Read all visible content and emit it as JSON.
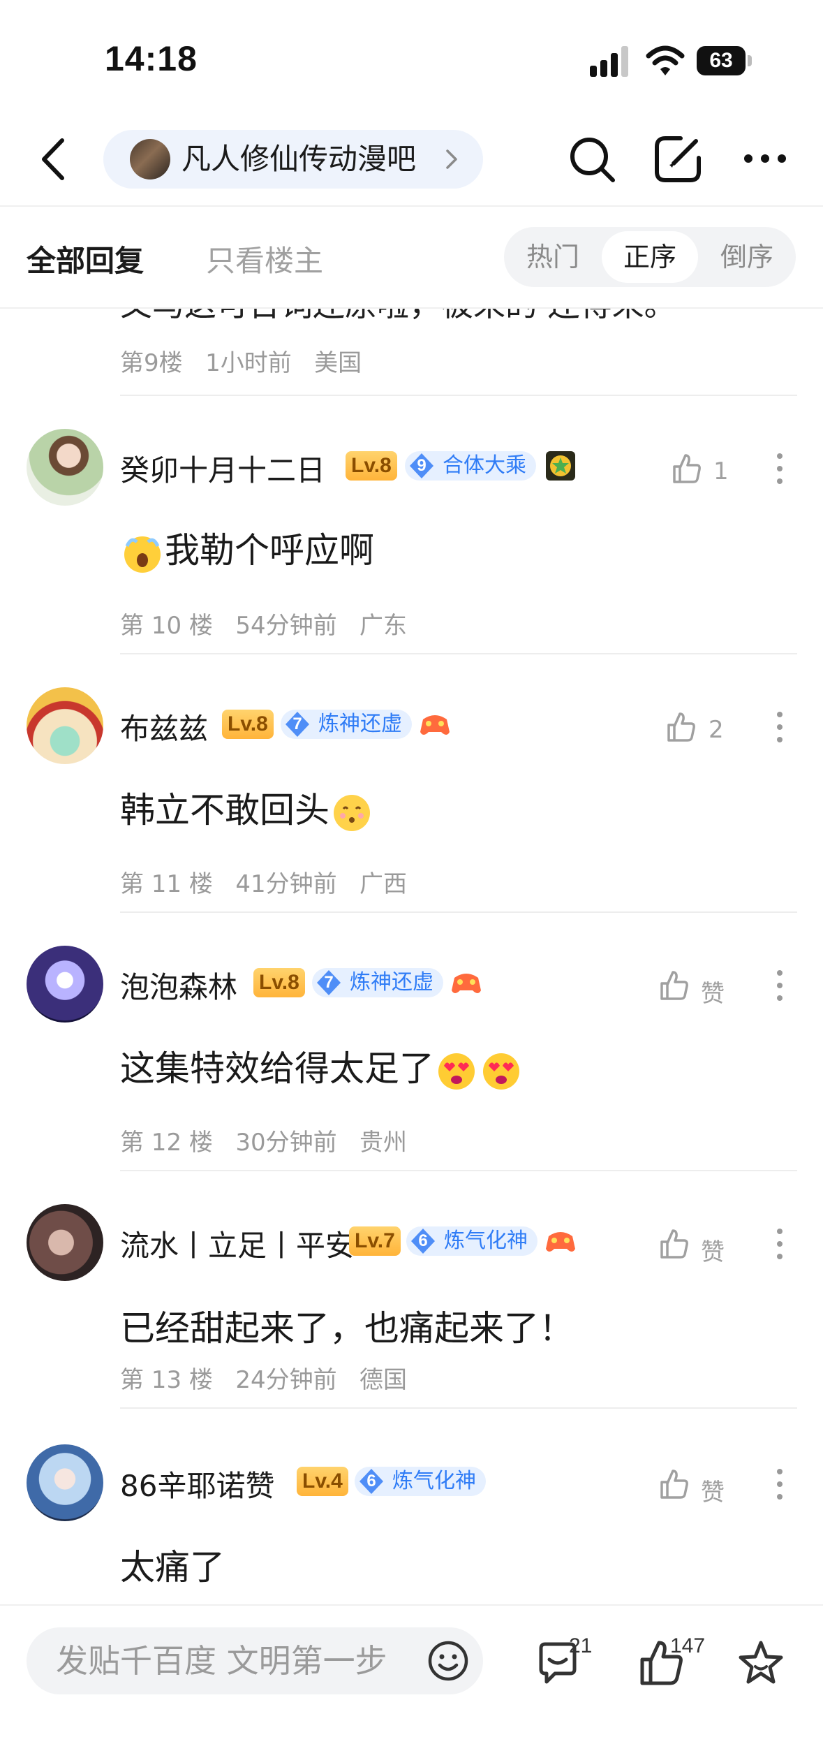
{
  "status_bar": {
    "time": "14:18",
    "battery": "63"
  },
  "nav": {
    "forum_name": "凡人修仙传动漫吧"
  },
  "filter": {
    "tab_all": "全部回复",
    "tab_host_only": "只看楼主",
    "sort_options": [
      "热门",
      "正序",
      "倒序"
    ],
    "sort_selected": "正序"
  },
  "previous_reply": {
    "content_clipped": "又马这可台词还原啦，被来的 还得来。",
    "floor": "第9楼",
    "time": "1小时前",
    "location": "美国"
  },
  "replies": [
    {
      "username": "癸卯十月十二日",
      "level": "Lv.8",
      "title_level": "9",
      "title": "合体大乘",
      "content": "我勒个呼应啊",
      "floor": "第 10 楼",
      "time": "54分钟前",
      "location": "广东",
      "likes": "1",
      "has_like_count": true
    },
    {
      "username": "布兹兹",
      "level": "Lv.8",
      "title_level": "7",
      "title": "炼神还虚",
      "content": "韩立不敢回头",
      "floor": "第 11 楼",
      "time": "41分钟前",
      "location": "广西",
      "likes": "2",
      "has_like_count": true
    },
    {
      "username": "泡泡森林",
      "level": "Lv.8",
      "title_level": "7",
      "title": "炼神还虚",
      "content": "这集特效给得太足了",
      "floor": "第 12 楼",
      "time": "30分钟前",
      "location": "贵州",
      "likes": "赞",
      "has_like_count": false
    },
    {
      "username": "流水丨立足丨平安",
      "level": "Lv.7",
      "title_level": "6",
      "title": "炼气化神",
      "content": "已经甜起来了，也痛起来了！",
      "floor": "第 13 楼",
      "time": "24分钟前",
      "location": "德国",
      "likes": "赞",
      "has_like_count": false
    },
    {
      "username": "86辛耶诺赞",
      "level": "Lv.4",
      "title_level": "6",
      "title": "炼气化神",
      "content": "太痛了",
      "likes": "赞",
      "has_like_count": false
    }
  ],
  "bottom_bar": {
    "input_placeholder": "发贴千百度 文明第一步",
    "comment_count": "21",
    "like_count": "147"
  },
  "colors": {
    "accent_blue": "#2f7cf6",
    "level_badge": "#ffb43a",
    "muted_text": "#9a9a9a"
  }
}
